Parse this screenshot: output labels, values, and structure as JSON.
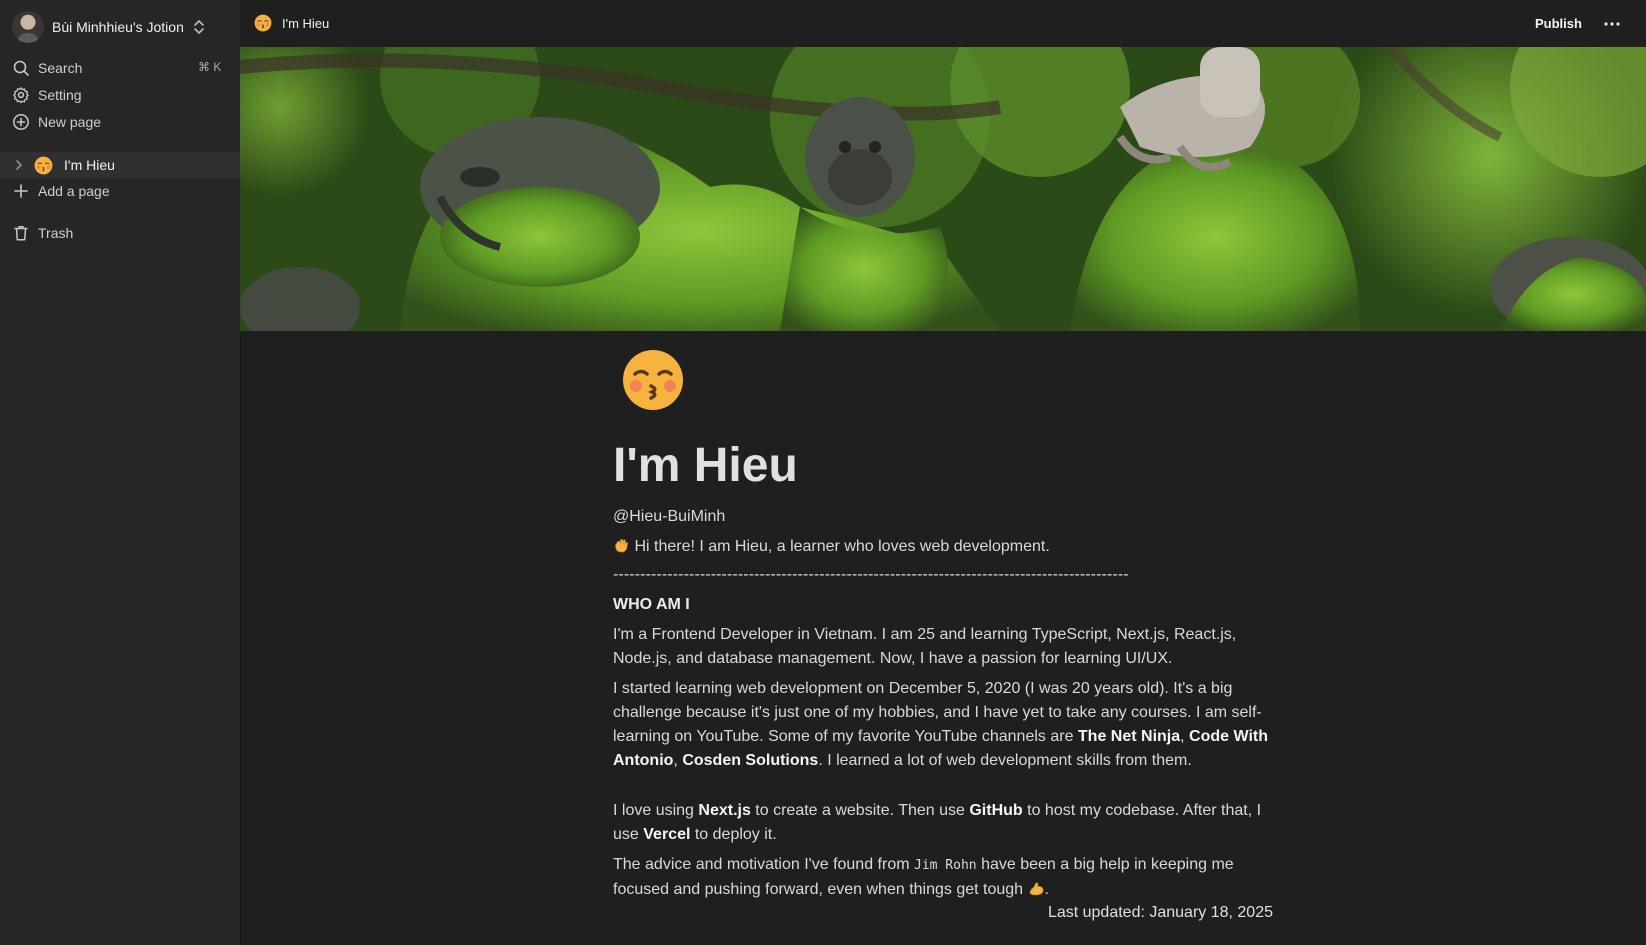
{
  "sidebar": {
    "workspace_name": "Bùi Minhhieu's Jotion",
    "search_label": "Search",
    "search_shortcut": "⌘ K",
    "settings_label": "Setting",
    "new_page_label": "New page",
    "pages": [
      {
        "label": "I'm Hieu",
        "emoji": "kissing-face-blushing"
      }
    ],
    "add_page_label": "Add a page",
    "trash_label": "Trash"
  },
  "topbar": {
    "page_title": "I'm Hieu",
    "publish_label": "Publish",
    "more_label": "···"
  },
  "document": {
    "icon": "kissing-face-blushing",
    "title": "I'm Hieu",
    "handle": "@Hieu-BuiMinh",
    "greeting": "Hi there! I am Hieu, a learner who loves web development.",
    "divider": "-----------------------------------------------------------------------------------------------",
    "section_heading": "WHO AM I",
    "paragraph_1": "I'm a Frontend Developer in Vietnam. I am 25 and learning TypeScript, Next.js, React.js, Node.js, and database management. Now, I have a passion for learning UI/UX.",
    "paragraph_2": {
      "text": "I started learning web development on December 5, 2020 (I was 20 years old). It's a big challenge because it's just one of my hobbies, and I have yet to take any courses. I am self-learning on YouTube. Some of my favorite YouTube channels are ",
      "channel_1": "The Net Ninja",
      "sep_1": ", ",
      "channel_2": "Code With Antonio",
      "sep_2": ", ",
      "channel_3": "Cosden Solutions",
      "tail": ". I learned a lot of web development skills from them."
    },
    "paragraph_3": {
      "a": "I love using ",
      "tool_1": "Next.js",
      "b": " to create a website. Then use ",
      "tool_2": "GitHub",
      "c": " to host my codebase. After that, I use ",
      "tool_3": "Vercel",
      "d": " to deploy it."
    },
    "paragraph_4": {
      "a": "The advice and motivation I've found from ",
      "mentor": "Jim Rohn",
      "b": " have been a big help in keeping me focused and pushing forward, even when things get tough ",
      "end": "."
    },
    "last_updated": "Last updated: January 18, 2025"
  },
  "colors": {
    "background": "#1f1f1f",
    "sidebar": "#262626",
    "active_row": "#303030",
    "text": "#d9d9d9"
  }
}
